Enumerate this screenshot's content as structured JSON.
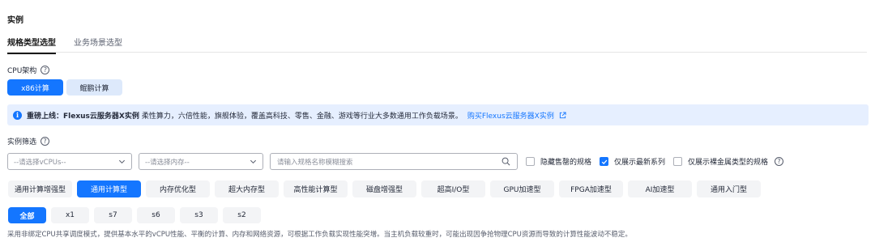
{
  "section_title": "实例",
  "tabs": [
    {
      "label": "规格类型选型",
      "active": true
    },
    {
      "label": "业务场景选型",
      "active": false
    }
  ],
  "cpu_arch": {
    "label": "CPU架构",
    "options": [
      {
        "label": "x86计算",
        "selected": true
      },
      {
        "label": "鲲鹏计算",
        "selected": false
      }
    ]
  },
  "notice": {
    "bold": "重磅上线：Flexus云服务器X实例",
    "text": "柔性算力，六倍性能，旗舰体验，覆盖高科技、零售、金融、游戏等行业大多数通用工作负载场景。",
    "link": "购买Flexus云服务器X实例"
  },
  "filter": {
    "label": "实例筛选",
    "vcpu_placeholder": "--请选择vCPUs--",
    "memory_placeholder": "--请选择内存--",
    "search_placeholder": "请输入规格名称模糊搜索",
    "hide_sold_out": {
      "label": "隐藏售罄的规格",
      "checked": false
    },
    "latest_series": {
      "label": "仅展示最新系列",
      "checked": true
    },
    "bare_metal": {
      "label": "仅展示裸金属类型的规格",
      "checked": false
    }
  },
  "instance_types": [
    {
      "label": "通用计算增强型",
      "active": false
    },
    {
      "label": "通用计算型",
      "active": true
    },
    {
      "label": "内存优化型",
      "active": false
    },
    {
      "label": "超大内存型",
      "active": false
    },
    {
      "label": "高性能计算型",
      "active": false
    },
    {
      "label": "磁盘增强型",
      "active": false
    },
    {
      "label": "超高I/O型",
      "active": false
    },
    {
      "label": "GPU加速型",
      "active": false
    },
    {
      "label": "FPGA加速型",
      "active": false
    },
    {
      "label": "AI加速型",
      "active": false
    },
    {
      "label": "通用入门型",
      "active": false
    }
  ],
  "series": [
    {
      "label": "全部",
      "active": true
    },
    {
      "label": "x1",
      "active": false
    },
    {
      "label": "s7",
      "active": false
    },
    {
      "label": "s6",
      "active": false
    },
    {
      "label": "s3",
      "active": false
    },
    {
      "label": "s2",
      "active": false
    }
  ],
  "description": "采用非绑定CPU共享调度模式，提供基本水平的vCPU性能、平衡的计算、内存和网络资源，可根据工作负载实现性能突增。当主机负载较重时，可能出现因争抢物理CPU资源而导致的计算性能波动不稳定。",
  "colors": {
    "accent": "#1476ff",
    "notice_bg": "#e6efff",
    "chip_bg": "#f3f4f6"
  }
}
